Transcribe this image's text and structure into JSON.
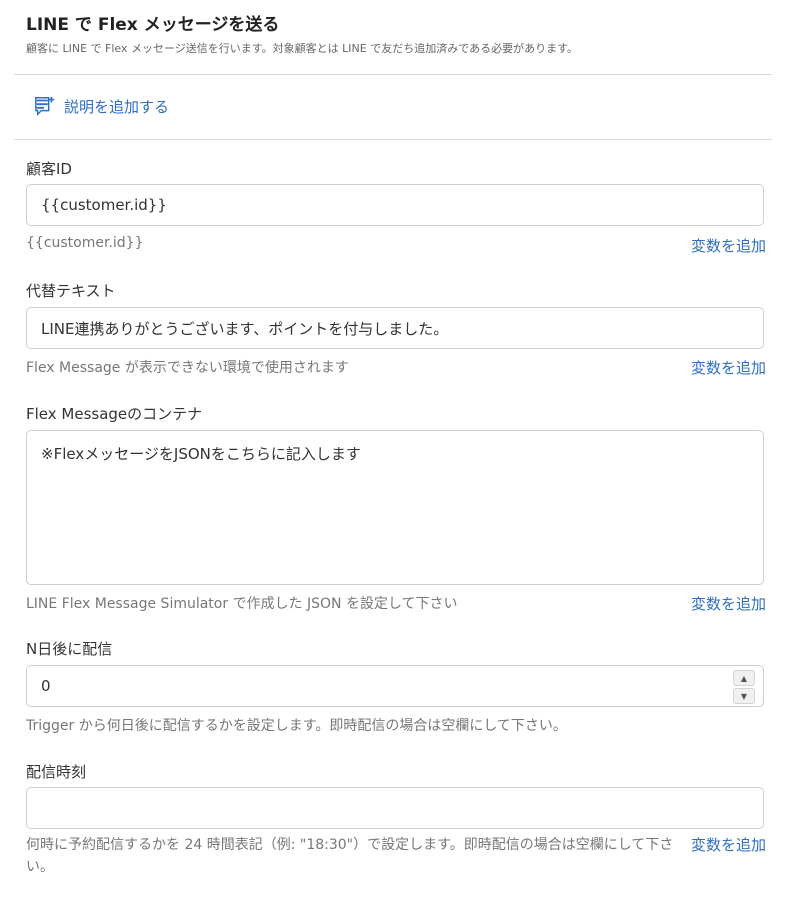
{
  "header": {
    "title": "LINE で Flex メッセージを送る",
    "subtitle": "顧客に LINE で Flex メッセージ送信を行います。対象顧客とは LINE で友だち追加済みである必要があります。"
  },
  "add_description_label": "説明を追加する",
  "fields": {
    "customer_id": {
      "label": "顧客ID",
      "value": "{{customer.id}}",
      "help": "{{customer.id}}",
      "add_variable": "変数を追加"
    },
    "alt_text": {
      "label": "代替テキスト",
      "value": "LINE連携ありがとうございます、ポイントを付与しました。",
      "help": "Flex Message が表示できない環境で使用されます",
      "add_variable": "変数を追加"
    },
    "flex_container": {
      "label": "Flex Messageのコンテナ",
      "value": "※FlexメッセージをJSONをこちらに記入します",
      "help": "LINE Flex Message Simulator で作成した JSON を設定して下さい",
      "add_variable": "変数を追加"
    },
    "days_after": {
      "label": "N日後に配信",
      "value": "0",
      "help": "Trigger から何日後に配信するかを設定します。即時配信の場合は空欄にして下さい。",
      "stepper_up": "▲",
      "stepper_down": "▼"
    },
    "delivery_time": {
      "label": "配信時刻",
      "value": "",
      "help": "何時に予約配信するかを 24 時間表記（例: \"18:30\"）で設定します。即時配信の場合は空欄にして下さい。",
      "add_variable": "変数を追加"
    }
  },
  "colors": {
    "link": "#2f6fbf",
    "border": "#cfcfcf",
    "divider": "#d9d9d9"
  }
}
